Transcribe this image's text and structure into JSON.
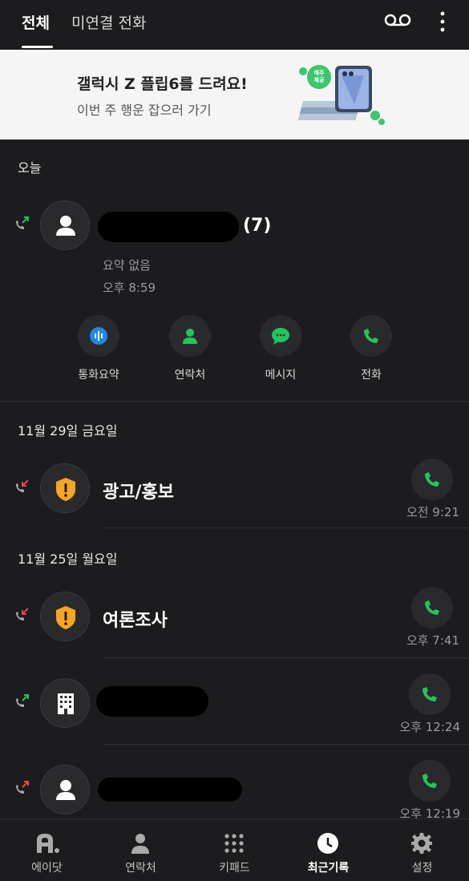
{
  "tabs": {
    "all": "전체",
    "missed": "미연결 전화"
  },
  "icons": {
    "voicemail": "voicemail-icon",
    "more": "more-vert-icon"
  },
  "banner": {
    "title": "갤럭시 Z 플립6를 드려요!",
    "subtitle": "이번 주 행운 잡으러 가기",
    "badge": "매주 제공"
  },
  "sections": {
    "today": "오늘",
    "nov29": "11월 29일 금요일",
    "nov25": "11월 25일 월요일"
  },
  "expanded": {
    "count": "(7)",
    "summary": "요약 없음",
    "time": "오후 8:59",
    "actions": {
      "summary": "통화요약",
      "contact": "연락처",
      "message": "메시지",
      "call": "전화"
    }
  },
  "calls": [
    {
      "name": "광고/홍보",
      "time": "오전 9:21"
    },
    {
      "name": "여론조사",
      "time": "오후 7:41"
    },
    {
      "name": "",
      "time": "오후 12:24"
    },
    {
      "name": "",
      "time": "오후 12:19"
    }
  ],
  "nav": {
    "a": "에이닷",
    "contacts": "연락처",
    "keypad": "키패드",
    "recents": "최근기록",
    "settings": "설정"
  },
  "colors": {
    "accent_green": "#22c55e",
    "missed_red": "#ef4444",
    "spam_amber": "#f5a623",
    "summary_blue": "#1e88e5"
  }
}
